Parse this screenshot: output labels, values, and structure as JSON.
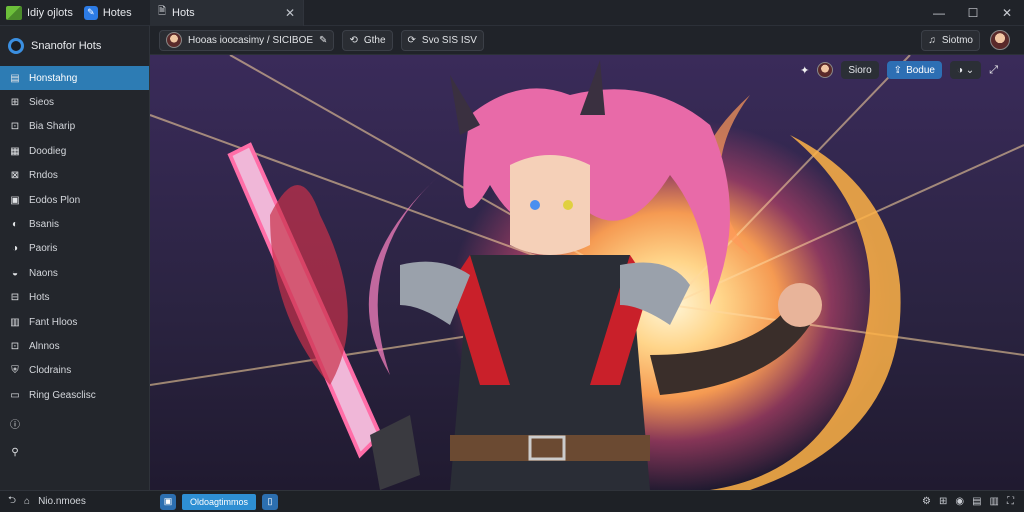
{
  "window": {
    "app_title": "Idiy ojlots",
    "notes_label": "Hotes",
    "tab_title": "Hots",
    "controls": {
      "minimize": "—",
      "maximize": "☐",
      "close": "✕"
    }
  },
  "sidebar": {
    "header_title": "Snanofor Hots",
    "items": [
      {
        "label": "Honstahng",
        "icon": "▤",
        "active": true
      },
      {
        "label": "Sieos",
        "icon": "⊞"
      },
      {
        "label": "Bia Sharip",
        "icon": "⊡"
      },
      {
        "label": "Doodieg",
        "icon": "▦"
      },
      {
        "label": "Rndos",
        "icon": "⊠"
      },
      {
        "label": "Eodos Plon",
        "icon": "▣"
      },
      {
        "label": "Bsanis",
        "icon": "◐"
      },
      {
        "label": "Paoris",
        "icon": "◑"
      },
      {
        "label": "Naons",
        "icon": "◒"
      },
      {
        "label": "Hots",
        "icon": "⊟"
      },
      {
        "label": "Fant Hloos",
        "icon": "▥"
      },
      {
        "label": "Alnnos",
        "icon": "⊡"
      },
      {
        "label": "Clodrains",
        "icon": "⛨"
      },
      {
        "label": "Ring Geasclisc",
        "icon": "▭"
      },
      {
        "label": "",
        "icon": "ⓘ"
      },
      {
        "label": "",
        "icon": "⚲"
      }
    ]
  },
  "toolbar": {
    "breadcrumb": "Hooas ioocasimy / SICIBOE",
    "chip2": "Gthe",
    "chip3": "Svo SIS ISV",
    "right_button": "Siotmo"
  },
  "overlay": {
    "btn1": "Sioro",
    "btn2": "Bodue"
  },
  "status": {
    "left_label": "Nio.nmoes",
    "pill": "Oldoagtimmos"
  }
}
